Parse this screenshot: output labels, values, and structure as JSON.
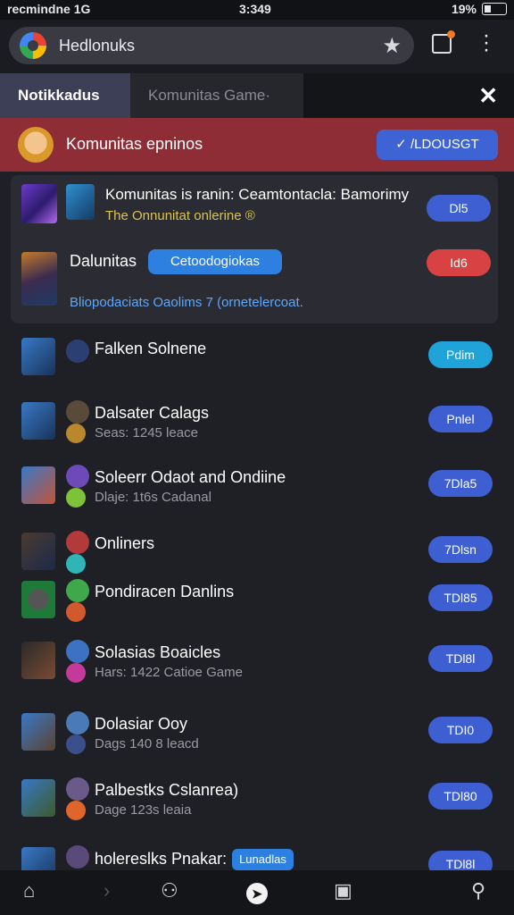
{
  "status": {
    "left": "recmindne 1G",
    "time": "3:349",
    "right": "19%"
  },
  "browser": {
    "url_text": "Hedlonuks"
  },
  "tabs": [
    {
      "label": "Notikkadus"
    },
    {
      "label": "Komunitas Game·"
    }
  ],
  "banner": {
    "title": "Komunitas epninos",
    "button": "✓ /LDOUSGT"
  },
  "card": {
    "title": "Komunitas is ranin: Ceamtontacla: Bamorimy",
    "subtitle": "The Onnunitat onlerine ®",
    "item2_title": "Dalunitas",
    "tag": "Cetoodogiokas",
    "footer": "Bliopodaciats Oaolims 7 (ornetelercoat.",
    "btn1": "Dl5",
    "btn2": "Id6"
  },
  "rows": [
    {
      "title": "Falken Solnene",
      "sub": "",
      "btn": "Pdim"
    },
    {
      "title": "Dalsater Calags",
      "sub": "Seas: 1245 leace",
      "btn": "Pnlel"
    },
    {
      "title": "Soleerr Odaot and Ondiine",
      "sub": "Dlaje: 1t6s Cadanal",
      "btn": "7Dla5"
    },
    {
      "title": "Onliners",
      "sub": "",
      "btn": "7Dlsn"
    },
    {
      "title": "Pondiracen Danlins",
      "sub": "",
      "btn": "TDl85"
    },
    {
      "title": "Solasias Boaicles",
      "sub": "Hars: 1422 Catioe Game",
      "btn": "TDl8l"
    },
    {
      "title": "Dolasiar Ooy",
      "sub": "Dags 140 8 leacd",
      "btn": "TDI0"
    },
    {
      "title": "Palbestks Cslanrea)",
      "sub": "Dage 123s leaia",
      "btn": "TDl80"
    },
    {
      "title": "holereslks Pnakar:",
      "sub": "",
      "tag": "Lunadlas",
      "btn": "TDl8l"
    }
  ]
}
